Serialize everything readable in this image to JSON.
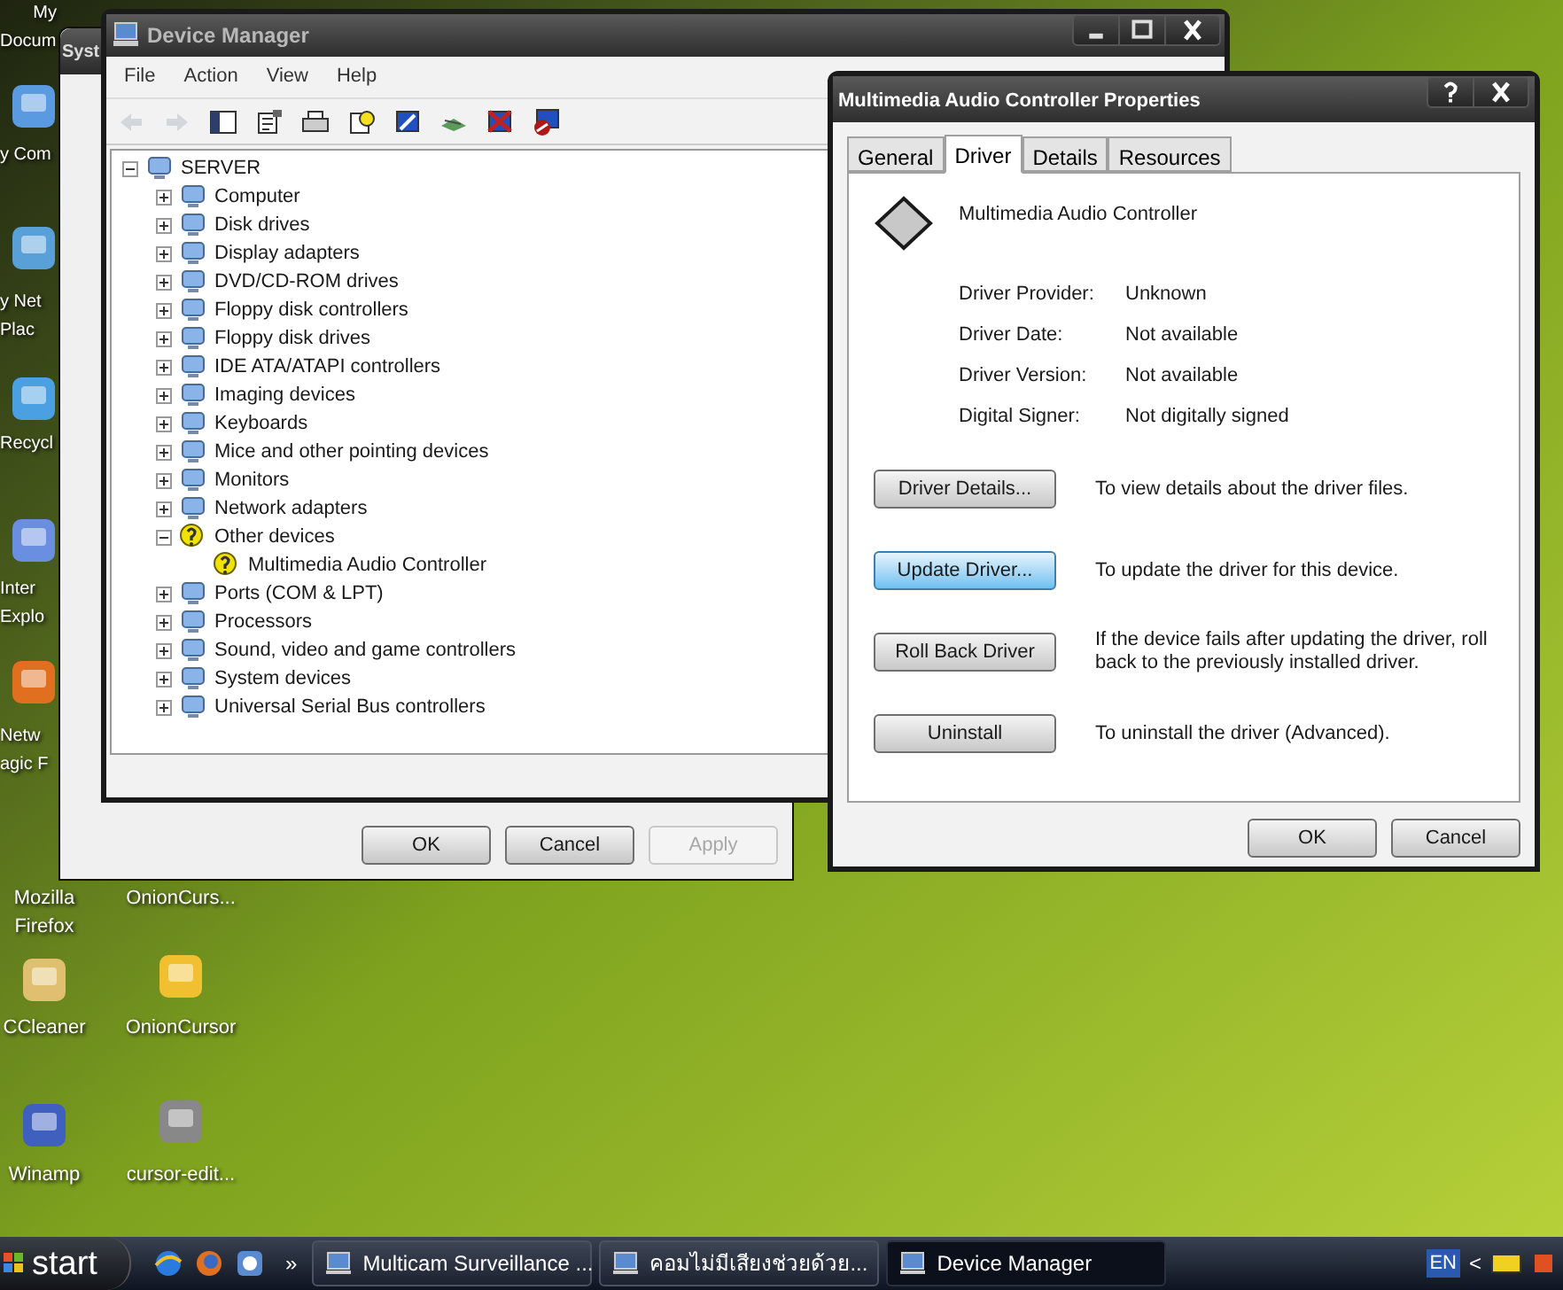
{
  "desktop_icons": [
    {
      "label_lines": [
        "My",
        "Docum"
      ]
    },
    {
      "label_lines": [
        "y Com"
      ]
    },
    {
      "label_lines": [
        "y Net",
        "Plac"
      ]
    },
    {
      "label_lines": [
        "Recycl"
      ]
    },
    {
      "label_lines": [
        "Inter",
        "Explo"
      ]
    },
    {
      "label_lines": [
        "Netw",
        "agic F"
      ]
    },
    {
      "label_lines": [
        "Mozilla",
        "Firefox"
      ]
    },
    {
      "label_lines": [
        "OnionCurs..."
      ]
    },
    {
      "label_lines": [
        "CCleaner"
      ]
    },
    {
      "label_lines": [
        "OnionCursor"
      ]
    },
    {
      "label_lines": [
        "Winamp"
      ]
    },
    {
      "label_lines": [
        "cursor-edit..."
      ]
    }
  ],
  "system_window": {
    "title": "Syst",
    "buttons": [
      {
        "label": "OK",
        "disabled": false
      },
      {
        "label": "Cancel",
        "disabled": false
      },
      {
        "label": "Apply",
        "disabled": true
      }
    ]
  },
  "device_manager": {
    "title": "Device Manager",
    "menu": [
      "File",
      "Action",
      "View",
      "Help"
    ],
    "toolbar": [
      {
        "kind": "back",
        "disabled": true
      },
      {
        "kind": "forward",
        "disabled": true
      },
      {
        "kind": "console",
        "disabled": false
      },
      {
        "kind": "properties",
        "disabled": false
      },
      {
        "kind": "print",
        "disabled": false
      },
      {
        "kind": "help",
        "disabled": false
      },
      {
        "kind": "scan",
        "disabled": false
      },
      {
        "kind": "update",
        "disabled": false
      },
      {
        "kind": "uninstall",
        "disabled": false
      },
      {
        "kind": "disable",
        "disabled": false
      }
    ],
    "tree": {
      "label": "SERVER",
      "expanded": true,
      "children": [
        {
          "label": "Computer",
          "expanded": false,
          "warning": false
        },
        {
          "label": "Disk drives",
          "expanded": false,
          "warning": false
        },
        {
          "label": "Display adapters",
          "expanded": false,
          "warning": false
        },
        {
          "label": "DVD/CD-ROM drives",
          "expanded": false,
          "warning": false
        },
        {
          "label": "Floppy disk controllers",
          "expanded": false,
          "warning": false
        },
        {
          "label": "Floppy disk drives",
          "expanded": false,
          "warning": false
        },
        {
          "label": "IDE ATA/ATAPI controllers",
          "expanded": false,
          "warning": false
        },
        {
          "label": "Imaging devices",
          "expanded": false,
          "warning": false
        },
        {
          "label": "Keyboards",
          "expanded": false,
          "warning": false
        },
        {
          "label": "Mice and other pointing devices",
          "expanded": false,
          "warning": false
        },
        {
          "label": "Monitors",
          "expanded": false,
          "warning": false
        },
        {
          "label": "Network adapters",
          "expanded": false,
          "warning": false
        },
        {
          "label": "Other devices",
          "expanded": true,
          "warning": true,
          "children": [
            {
              "label": "Multimedia Audio Controller",
              "warning": true
            }
          ]
        },
        {
          "label": "Ports (COM & LPT)",
          "expanded": false,
          "warning": false
        },
        {
          "label": "Processors",
          "expanded": false,
          "warning": false
        },
        {
          "label": "Sound, video and game controllers",
          "expanded": false,
          "warning": false
        },
        {
          "label": "System devices",
          "expanded": false,
          "warning": false
        },
        {
          "label": "Universal Serial Bus controllers",
          "expanded": false,
          "warning": false
        }
      ]
    }
  },
  "properties": {
    "title": "Multimedia Audio Controller Properties",
    "tabs": [
      {
        "label": "General",
        "selected": false
      },
      {
        "label": "Driver",
        "selected": true
      },
      {
        "label": "Details",
        "selected": false
      },
      {
        "label": "Resources",
        "selected": false
      }
    ],
    "device_name": "Multimedia Audio Controller",
    "fields": [
      {
        "label": "Driver Provider:",
        "value": "Unknown"
      },
      {
        "label": "Driver Date:",
        "value": "Not available"
      },
      {
        "label": "Driver Version:",
        "value": "Not available"
      },
      {
        "label": "Digital Signer:",
        "value": "Not digitally signed"
      }
    ],
    "actions": [
      {
        "button": "Driver Details...",
        "description": "To view details about the driver files.",
        "focused": false
      },
      {
        "button": "Update Driver...",
        "description": "To update the driver for this device.",
        "focused": true
      },
      {
        "button": "Roll Back Driver",
        "description": "If the device fails after updating the driver, roll back to the previously installed driver.",
        "focused": false
      },
      {
        "button": "Uninstall",
        "description": "To uninstall the driver (Advanced).",
        "focused": false
      }
    ],
    "buttons": [
      "OK",
      "Cancel"
    ]
  },
  "taskbar": {
    "start": "start",
    "overflow": "»",
    "tasks": [
      {
        "label": "Multicam Surveillance ...",
        "selected": false
      },
      {
        "label": "คอมไม่มีเสียงช่วยด้วย...",
        "selected": false
      },
      {
        "label": "Device Manager",
        "selected": true
      }
    ],
    "language": "EN",
    "tray_toggle": "<"
  }
}
